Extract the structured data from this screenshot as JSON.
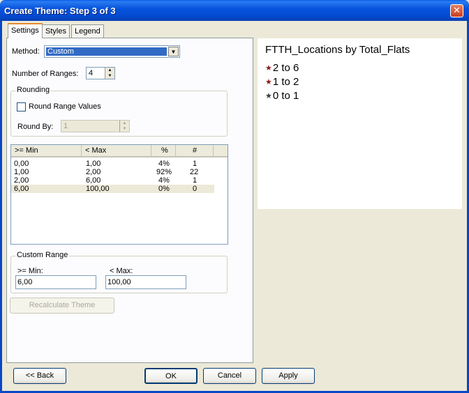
{
  "window": {
    "title": "Create Theme: Step 3 of 3",
    "close_glyph": "✕"
  },
  "tabs": [
    {
      "label": "Settings",
      "active": true
    },
    {
      "label": "Styles",
      "active": false
    },
    {
      "label": "Legend",
      "active": false
    }
  ],
  "settings": {
    "method_label": "Method:",
    "method_value": "Custom",
    "ranges_label": "Number of Ranges:",
    "ranges_value": "4",
    "rounding": {
      "title": "Rounding",
      "checkbox_label": "Round Range Values",
      "checked": false,
      "round_by_label": "Round By:",
      "round_by_value": "1"
    },
    "table": {
      "headers": [
        ">= Min",
        "< Max",
        "%",
        "#"
      ],
      "rows": [
        {
          "min": "0,00",
          "max": "1,00",
          "pct": "4%",
          "count": "1"
        },
        {
          "min": "1,00",
          "max": "2,00",
          "pct": "92%",
          "count": "22"
        },
        {
          "min": "2,00",
          "max": "6,00",
          "pct": "4%",
          "count": "1"
        },
        {
          "min": "6,00",
          "max": "100,00",
          "pct": "0%",
          "count": "0"
        }
      ]
    },
    "custom_range": {
      "title": "Custom Range",
      "min_label": ">= Min:",
      "min_value": "6,00",
      "max_label": "< Max:",
      "max_value": "100,00"
    },
    "recalculate_label": "Recalculate Theme"
  },
  "preview": {
    "title": "FTTH_Locations by Total_Flats",
    "items": [
      {
        "label": "2 to 6",
        "color": "#8b1a1a"
      },
      {
        "label": "1 to 2",
        "color": "#8b1a1a"
      },
      {
        "label": "0 to 1",
        "color": "#3a3a3a"
      }
    ],
    "star_glyph": "★"
  },
  "footer": {
    "back_label": "<< Back",
    "ok_label": "OK",
    "cancel_label": "Cancel",
    "apply_label": "Apply"
  },
  "colors": {
    "titlebar": "#0855dd",
    "selection": "#316ac5",
    "tab_accent": "#e68b2c"
  }
}
